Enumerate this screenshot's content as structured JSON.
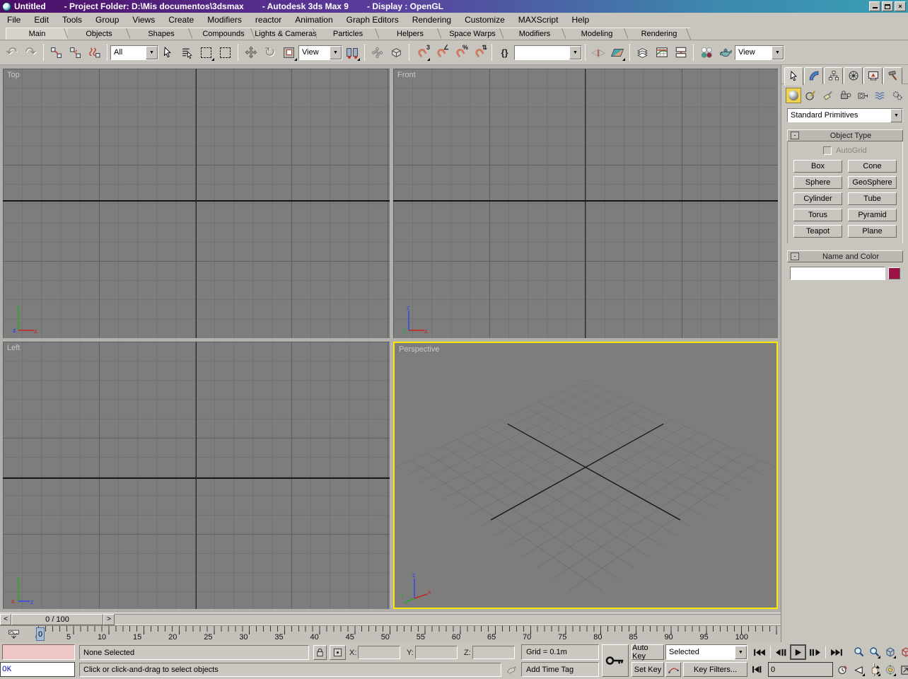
{
  "window": {
    "title_parts": [
      "Untitled",
      "- Project Folder: D:\\Mis documentos\\3dsmax",
      "- Autodesk 3ds Max 9",
      "- Display : OpenGL"
    ]
  },
  "menubar": {
    "items": [
      "File",
      "Edit",
      "Tools",
      "Group",
      "Views",
      "Create",
      "Modifiers",
      "reactor",
      "Animation",
      "Graph Editors",
      "Rendering",
      "Customize",
      "MAXScript",
      "Help"
    ]
  },
  "tabbar": {
    "tabs": [
      "Main",
      "Objects",
      "Shapes",
      "Compounds",
      "Lights & Cameras",
      "Particles",
      "Helpers",
      "Space Warps",
      "Modifiers",
      "Modeling",
      "Rendering"
    ]
  },
  "toolbar": {
    "selection_filter_value": "All",
    "coord_system_value": "View",
    "named_selection_value": "",
    "render_type_value": "View"
  },
  "icons": {
    "undo": "↶",
    "redo": "↷",
    "rotate": "↻",
    "snap3_sup": "3",
    "angle_sup": "∠",
    "percent_sup": "%",
    "spinner_sup": "⇅",
    "named_sets": "{}",
    "mirror_l": "◁",
    "mirror_bar": "|",
    "mirror_r": "▷",
    "minimize": "",
    "close": "×",
    "slider_prev": "<",
    "slider_next": ">",
    "waves": "≈"
  },
  "viewports": {
    "top_label": "Top",
    "front_label": "Front",
    "left_label": "Left",
    "perspective_label": "Perspective"
  },
  "timeline": {
    "slider_value": "0 / 100",
    "thumb_value": "0",
    "ruler_numbers": [
      "0",
      "5",
      "10",
      "15",
      "20",
      "25",
      "30",
      "35",
      "40",
      "45",
      "50",
      "55",
      "60",
      "65",
      "70",
      "75",
      "80",
      "85",
      "90",
      "95",
      "100"
    ]
  },
  "status": {
    "listener_text": "OK",
    "none_selected": "None Selected",
    "prompt": "Click or click-and-drag to select objects",
    "x_label": "X:",
    "y_label": "Y:",
    "z_label": "Z:",
    "x_value": "",
    "y_value": "",
    "z_value": "",
    "grid_text": "Grid = 0.1m",
    "add_time_tag": "Add Time Tag",
    "auto_key": "Auto Key",
    "set_key": "Set Key",
    "selected_combo_value": "Selected",
    "key_filters": "Key Filters...",
    "frame_value": "0"
  },
  "panel": {
    "tabs": [
      "create",
      "modify",
      "hierarchy",
      "motion",
      "display",
      "utilities"
    ],
    "categories": [
      "geometry",
      "shapes",
      "lights",
      "cameras",
      "helpers",
      "space-warps",
      "systems"
    ],
    "dropdown_value": "Standard Primitives",
    "object_type": {
      "collapse": "-",
      "title": "Object Type",
      "autogrid": "AutoGrid",
      "buttons": [
        "Box",
        "Cone",
        "Sphere",
        "GeoSphere",
        "Cylinder",
        "Tube",
        "Torus",
        "Pyramid",
        "Teapot",
        "Plane"
      ]
    },
    "name_and_color": {
      "collapse": "-",
      "title": "Name and Color",
      "field_value": "",
      "swatch_style": "background:#9e1146"
    }
  },
  "colors": {
    "active_viewport_border": "#ffe800",
    "category_active_bg": "#efd24b",
    "name_color_swatch": "#9e1146",
    "title_gradient_left": "#4c0d66",
    "title_gradient_right": "#3a9fb4",
    "viewport_background": "#7d7d7d"
  }
}
